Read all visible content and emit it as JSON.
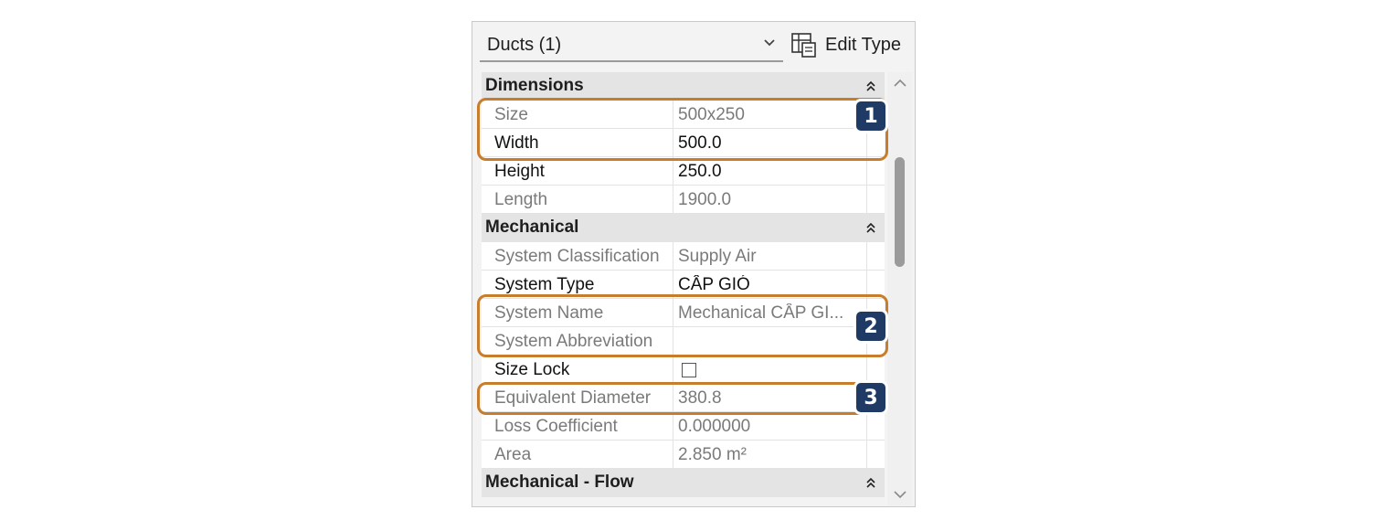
{
  "header": {
    "selector_label": "Ducts (1)",
    "edit_type_label": "Edit Type"
  },
  "sections": {
    "dimensions": {
      "title": "Dimensions",
      "size": {
        "name": "Size",
        "value": "500x250"
      },
      "width": {
        "name": "Width",
        "value": "500.0"
      },
      "height": {
        "name": "Height",
        "value": "250.0"
      },
      "length": {
        "name": "Length",
        "value": "1900.0"
      }
    },
    "mechanical": {
      "title": "Mechanical",
      "system_classification": {
        "name": "System Classification",
        "value": "Supply Air"
      },
      "system_type": {
        "name": "System Type",
        "value": "CẤP GIÓ"
      },
      "system_name": {
        "name": "System Name",
        "value": "Mechanical CẤP GI..."
      },
      "system_abbreviation": {
        "name": "System Abbreviation",
        "value": ""
      },
      "size_lock": {
        "name": "Size Lock",
        "checked": false
      },
      "equivalent_diameter": {
        "name": "Equivalent Diameter",
        "value": "380.8"
      },
      "loss_coefficient": {
        "name": "Loss Coefficient",
        "value": "0.000000"
      },
      "area": {
        "name": "Area",
        "value": "2.850 m²"
      }
    },
    "mechanical_flow": {
      "title": "Mechanical - Flow"
    }
  },
  "callouts": [
    {
      "label": "1"
    },
    {
      "label": "2"
    },
    {
      "label": "3"
    }
  ],
  "colors": {
    "callout_border": "#c87d2c",
    "badge_fill": "#1f3a64"
  }
}
